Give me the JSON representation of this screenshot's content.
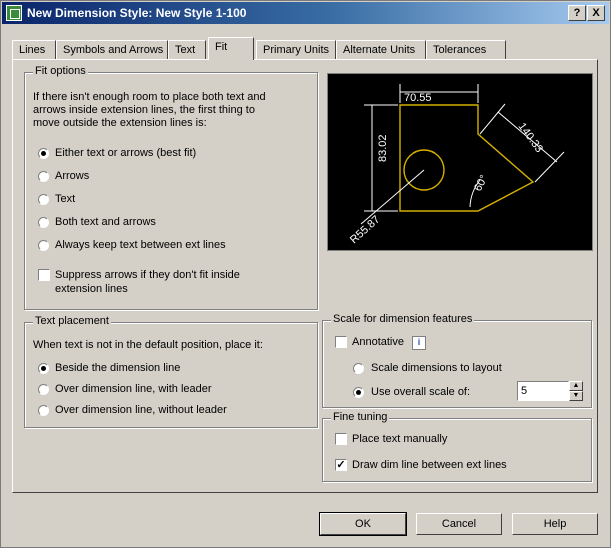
{
  "window": {
    "title": "New Dimension Style: New Style 1-100"
  },
  "titlebar_buttons": {
    "help": "?",
    "close": "X"
  },
  "tabs": [
    {
      "label": "Lines"
    },
    {
      "label": "Symbols and Arrows"
    },
    {
      "label": "Text"
    },
    {
      "label": "Fit"
    },
    {
      "label": "Primary Units"
    },
    {
      "label": "Alternate Units"
    },
    {
      "label": "Tolerances"
    }
  ],
  "fit_options": {
    "legend": "Fit options",
    "description_lines": [
      "If there isn't enough room to place both text and",
      "arrows inside extension lines, the first thing to",
      "move outside the extension lines is:"
    ],
    "radios": [
      {
        "label": "Either text or arrows (best fit)",
        "selected": true
      },
      {
        "label": "Arrows",
        "selected": false
      },
      {
        "label": "Text",
        "selected": false
      },
      {
        "label": "Both text and arrows",
        "selected": false
      },
      {
        "label": "Always keep text between ext lines",
        "selected": false
      }
    ],
    "suppress_label_lines": [
      "Suppress arrows if they don't fit inside",
      "extension lines"
    ],
    "suppress_checked": false
  },
  "text_placement": {
    "legend": "Text placement",
    "description": "When text is not in the default position, place it:",
    "radios": [
      {
        "label": "Beside the dimension line",
        "selected": true
      },
      {
        "label": "Over dimension line, with leader",
        "selected": false
      },
      {
        "label": "Over dimension line, without leader",
        "selected": false
      }
    ]
  },
  "preview": {
    "dims": [
      "70.55",
      "83.02",
      "140.33",
      "60°",
      "R55.87"
    ],
    "colors": {
      "background": "#000000",
      "dimension": "#ffffff",
      "geometry": "#d4b000"
    }
  },
  "scale": {
    "legend": "Scale for dimension features",
    "annotative_label": "Annotative",
    "annotative_checked": false,
    "info_icon": "i",
    "radios": [
      {
        "label": "Scale dimensions to layout",
        "selected": false
      },
      {
        "label": "Use overall scale of:",
        "selected": true
      }
    ],
    "overall_scale_value": "5"
  },
  "fine_tuning": {
    "legend": "Fine tuning",
    "checks": [
      {
        "label": "Place text manually",
        "checked": false
      },
      {
        "label": "Draw dim line between ext lines",
        "checked": true
      }
    ]
  },
  "buttons": {
    "ok": "OK",
    "cancel": "Cancel",
    "help": "Help"
  },
  "colors": {
    "title_start": "#0a246a",
    "title_end": "#a6caf0",
    "face": "#d4d0c8"
  }
}
